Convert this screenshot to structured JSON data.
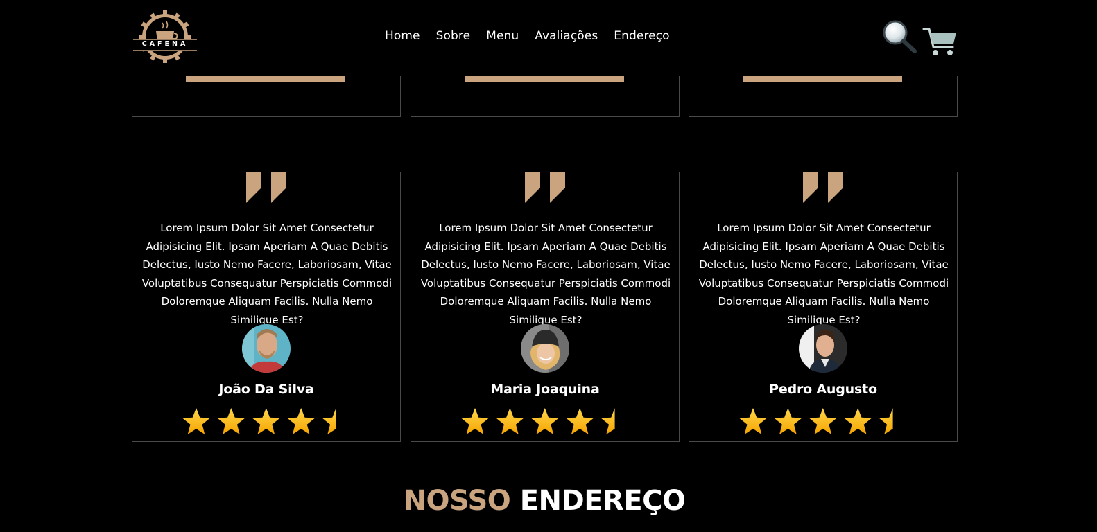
{
  "brand": {
    "logo_text": "CAFENA",
    "accent_color": "#c9a47f"
  },
  "nav": {
    "items": [
      "Home",
      "Sobre",
      "Menu",
      "Avaliações",
      "Endereço"
    ]
  },
  "header_icons": {
    "search": "search-icon",
    "cart": "cart-icon"
  },
  "reviews": [
    {
      "text": "Lorem Ipsum Dolor Sit Amet Consectetur Adipisicing Elit. Ipsam Aperiam A Quae Debitis Delectus, Iusto Nemo Facere, Laboriosam, Vitae Voluptatibus Consequatur Perspiciatis Commodi Doloremque Aliquam Facilis. Nulla Nemo Similique Est?",
      "name": "João Da Silva",
      "rating": 4.5
    },
    {
      "text": "Lorem Ipsum Dolor Sit Amet Consectetur Adipisicing Elit. Ipsam Aperiam A Quae Debitis Delectus, Iusto Nemo Facere, Laboriosam, Vitae Voluptatibus Consequatur Perspiciatis Commodi Doloremque Aliquam Facilis. Nulla Nemo Similique Est?",
      "name": "Maria Joaquina",
      "rating": 4.5
    },
    {
      "text": "Lorem Ipsum Dolor Sit Amet Consectetur Adipisicing Elit. Ipsam Aperiam A Quae Debitis Delectus, Iusto Nemo Facere, Laboriosam, Vitae Voluptatibus Consequatur Perspiciatis Commodi Doloremque Aliquam Facilis. Nulla Nemo Similique Est?",
      "name": "Pedro Augusto",
      "rating": 4.5
    }
  ],
  "section": {
    "title_accent": "NOSSO",
    "title_main": "ENDEREÇO"
  }
}
